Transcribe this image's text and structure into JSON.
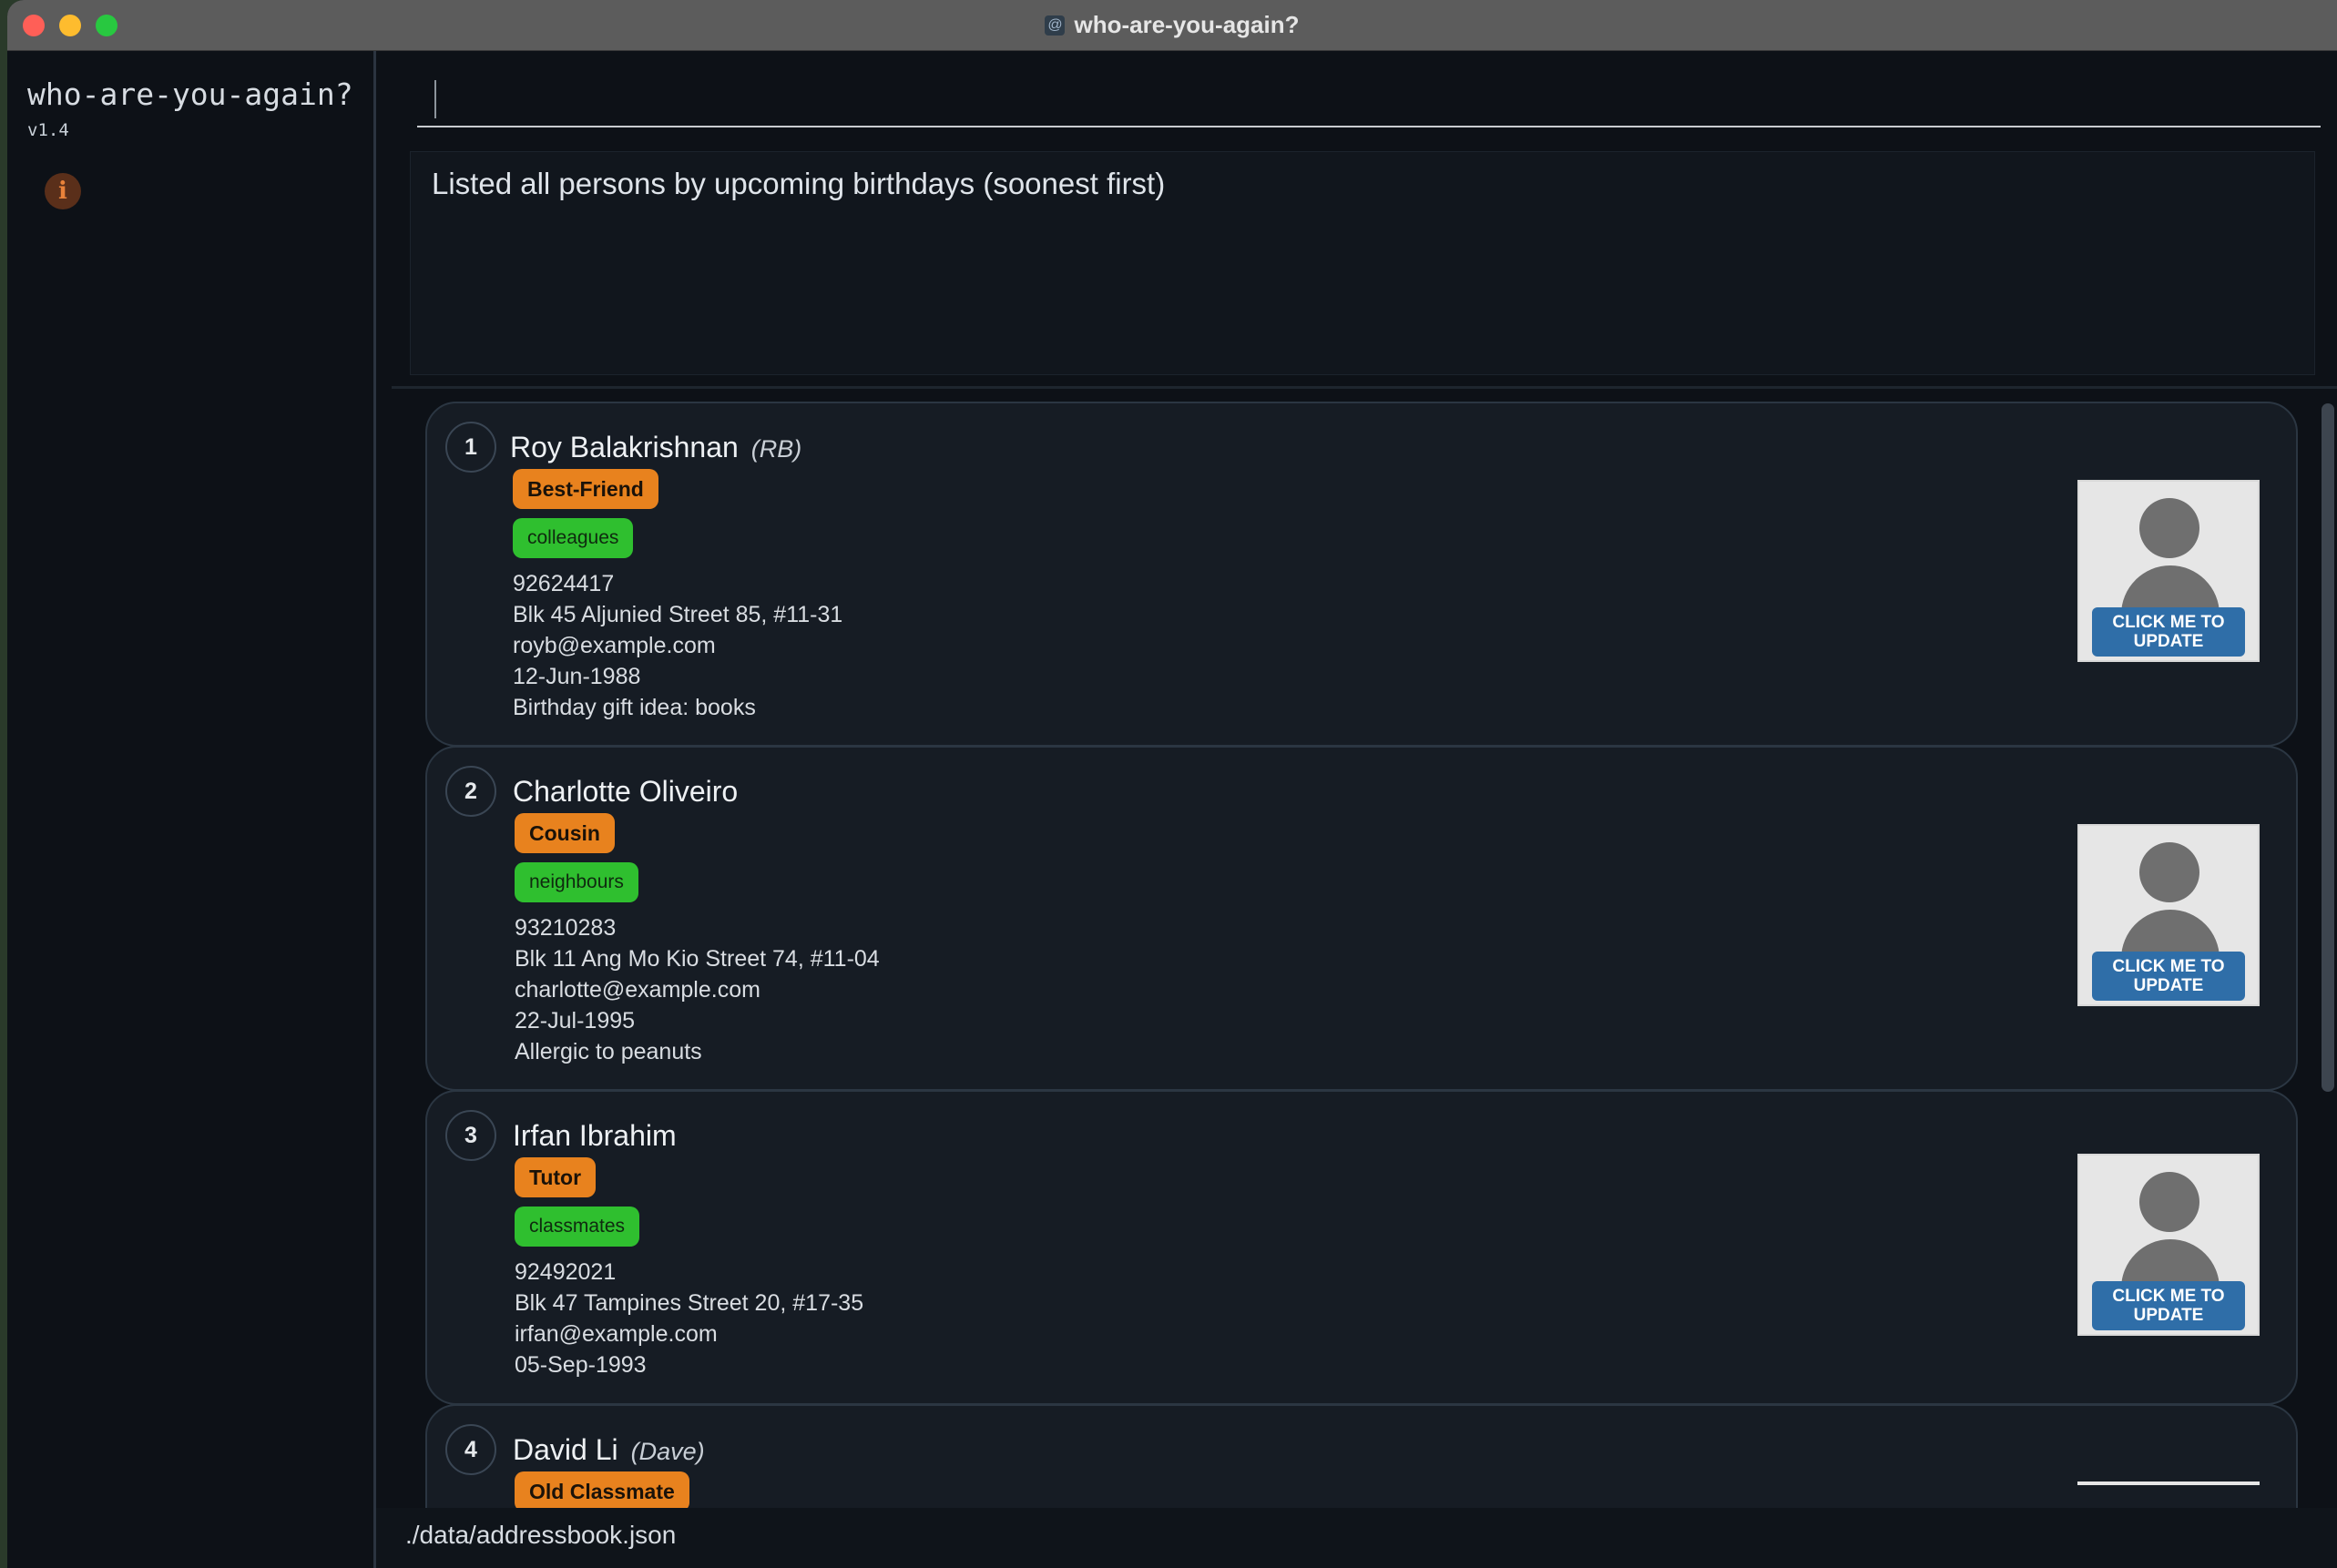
{
  "window": {
    "title": "who-are-you-again?"
  },
  "sidebar": {
    "app_name": "who-are-you-again?",
    "version": "v1.4",
    "info_icon": "i"
  },
  "command": {
    "value": "",
    "placeholder": ""
  },
  "result": {
    "message": "Listed all persons by upcoming birthdays (soonest first)"
  },
  "avatar_button_label": "CLICK ME TO UPDATE",
  "persons": [
    {
      "index": "1",
      "name": "Roy Balakrishnan",
      "nickname": "(RB)",
      "relationship": "Best-Friend",
      "tag": "colleagues",
      "phone": "92624417",
      "address": "Blk 45 Aljunied Street 85, #11-31",
      "email": "royb@example.com",
      "birthday": "12-Jun-1988",
      "remark": "Birthday gift idea: books"
    },
    {
      "index": "2",
      "name": "Charlotte Oliveiro",
      "nickname": "",
      "relationship": "Cousin",
      "tag": "neighbours",
      "phone": "93210283",
      "address": "Blk 11 Ang Mo Kio Street 74, #11-04",
      "email": "charlotte@example.com",
      "birthday": "22-Jul-1995",
      "remark": "Allergic to peanuts"
    },
    {
      "index": "3",
      "name": "Irfan Ibrahim",
      "nickname": "",
      "relationship": "Tutor",
      "tag": "classmates",
      "phone": "92492021",
      "address": "Blk 47 Tampines Street 20, #17-35",
      "email": "irfan@example.com",
      "birthday": "05-Sep-1993",
      "remark": ""
    },
    {
      "index": "4",
      "name": "David Li",
      "nickname": "(Dave)",
      "relationship": "Old Classmate"
    }
  ],
  "status": {
    "file_path": "./data/addressbook.json"
  },
  "colors": {
    "relationship_tag": "#e8821e",
    "tag": "#2fbf2f",
    "avatar_button": "#2f6ea8",
    "background": "#0d1117"
  }
}
